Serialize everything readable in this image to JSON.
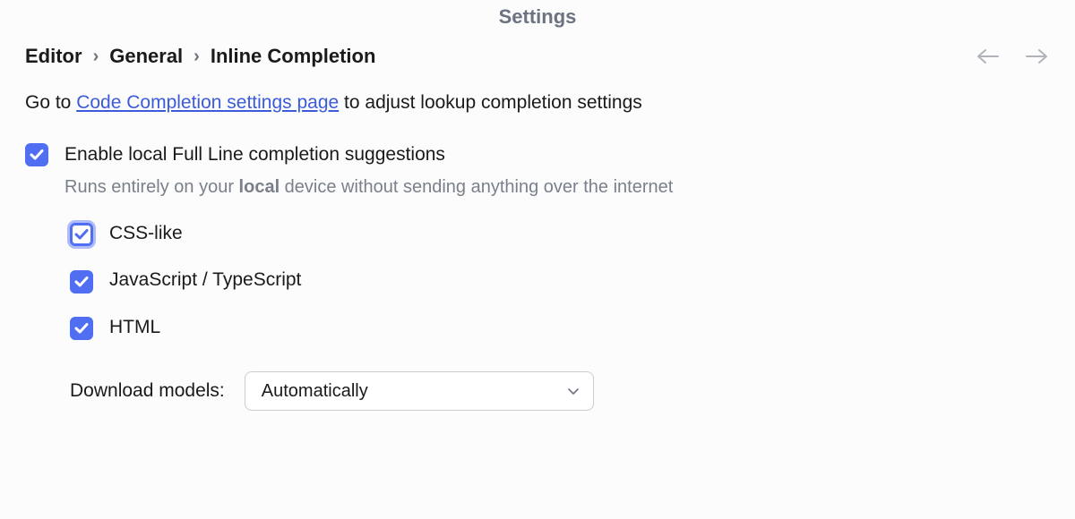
{
  "title": "Settings",
  "breadcrumb": {
    "item0": "Editor",
    "item1": "General",
    "item2": "Inline Completion"
  },
  "intro": {
    "prefix": "Go to ",
    "link": "Code Completion settings page",
    "suffix": " to adjust lookup completion settings"
  },
  "fullline": {
    "label": "Enable local Full Line completion suggestions",
    "sub_prefix": "Runs entirely on your ",
    "sub_bold": "local",
    "sub_suffix": " device without sending anything over the internet",
    "langs": {
      "css": "CSS-like",
      "js": "JavaScript / TypeScript",
      "html": "HTML"
    }
  },
  "download": {
    "label": "Download models:",
    "value": "Automatically"
  }
}
